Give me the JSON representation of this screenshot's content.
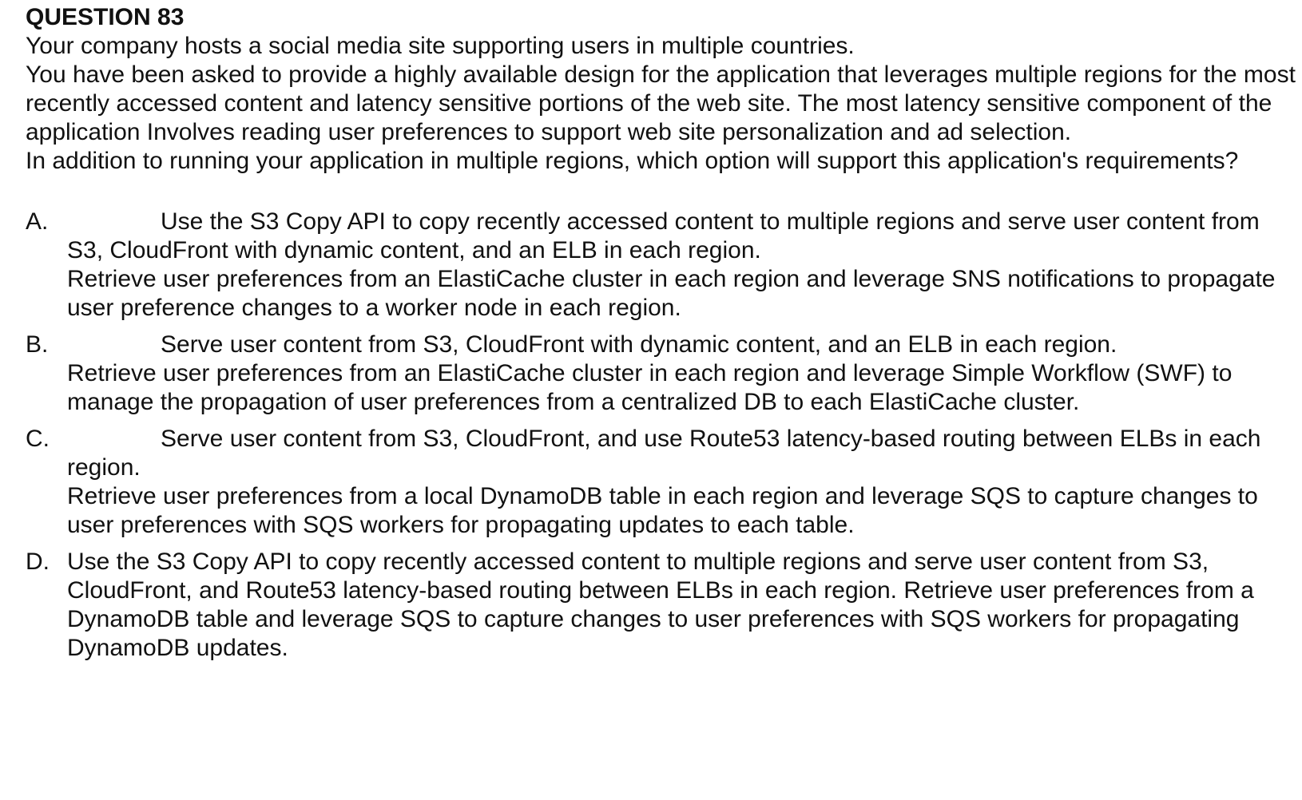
{
  "question": {
    "title": "QUESTION 83",
    "stem": [
      "Your company hosts a social media site supporting users in multiple countries.",
      "You have been asked to provide a highly available design for the application that leverages multiple regions for the most recently accessed content and latency sensitive portions of the web site. The most latency sensitive component of the application Involves reading user preferences to support web site personalization and ad selection.",
      "In addition to running your application in multiple regions, which option will support this application's requirements?"
    ]
  },
  "options": [
    {
      "letter": "A.",
      "lines": [
        "Use the S3 Copy API to copy recently accessed content to multiple regions and serve user content from S3, CloudFront with dynamic content, and an ELB in each region.",
        "Retrieve user preferences from an ElastiCache cluster in each region and leverage SNS notifications to propagate user preference changes to a worker node in each region."
      ]
    },
    {
      "letter": "B.",
      "lines": [
        "Serve user content from S3, CloudFront with dynamic content, and an ELB in each region.",
        "Retrieve user preferences from an ElastiCache cluster in each region and leverage Simple Workflow (SWF) to manage the propagation of user preferences from a centralized DB to each ElastiCache cluster."
      ]
    },
    {
      "letter": "C.",
      "lines": [
        "Serve user content from S3, CloudFront, and use Route53 latency-based routing between ELBs in each region.",
        "Retrieve user preferences from a local DynamoDB table in each region and leverage SQS to capture changes to user preferences with SQS workers for propagating updates to each table."
      ]
    },
    {
      "letter": "D.",
      "lines": [
        "Use the S3 Copy API to copy recently accessed content to multiple regions and serve user content from S3, CloudFront, and Route53 latency-based routing between ELBs in each region. Retrieve user preferences from a DynamoDB table and leverage SQS to capture changes to user preferences with SQS workers for propagating DynamoDB updates."
      ]
    }
  ]
}
